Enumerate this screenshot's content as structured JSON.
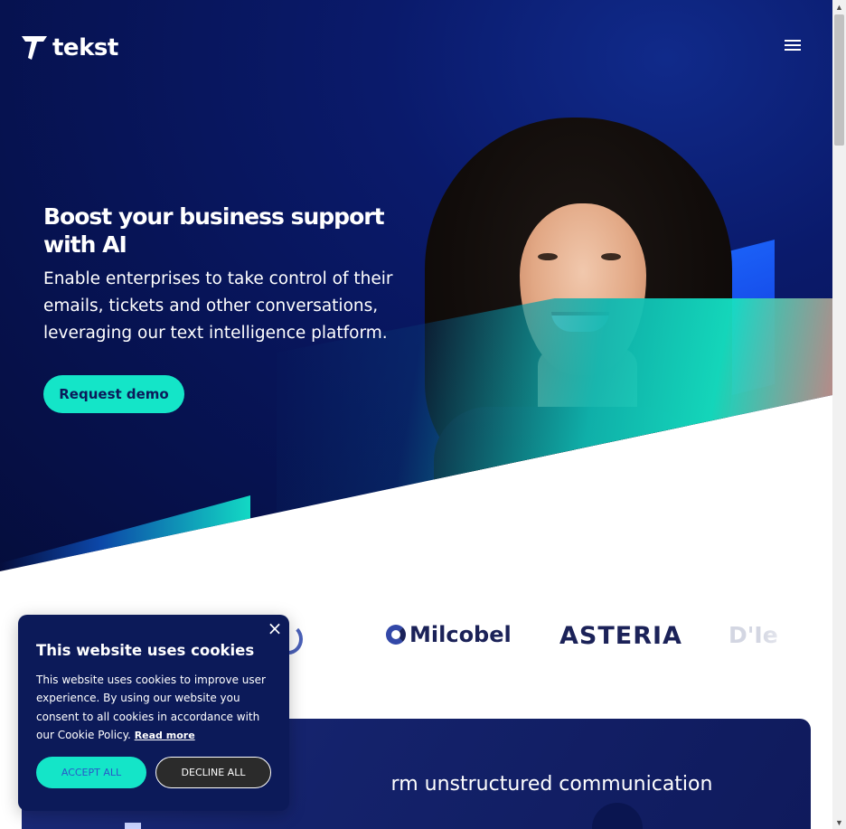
{
  "header": {
    "logo_text": "tekst",
    "menu_icon": "hamburger-menu-icon"
  },
  "hero": {
    "title": "Boost your business support with AI",
    "subtitle": "Enable enterprises to take control of their emails, tickets and other conversations, leveraging our text intelligence platform.",
    "cta_label": "Request demo"
  },
  "logos": {
    "items": [
      "Milcobel",
      "ASTERIA",
      "D'Ie"
    ]
  },
  "platform": {
    "title_visible": "rm unstructured communication"
  },
  "cookie_banner": {
    "title": "This website uses cookies",
    "text": "This website uses cookies to improve user experience. By using our website you consent to all cookies in accordance with our Cookie Policy.",
    "read_more": "Read more",
    "accept_label": "ACCEPT ALL",
    "decline_label": "DECLINE ALL",
    "close_label": "×"
  },
  "colors": {
    "hero_bg": "#071457",
    "accent": "#14e5c8",
    "cookie_bg": "#0c1a59",
    "text_dark": "#1b2258"
  }
}
